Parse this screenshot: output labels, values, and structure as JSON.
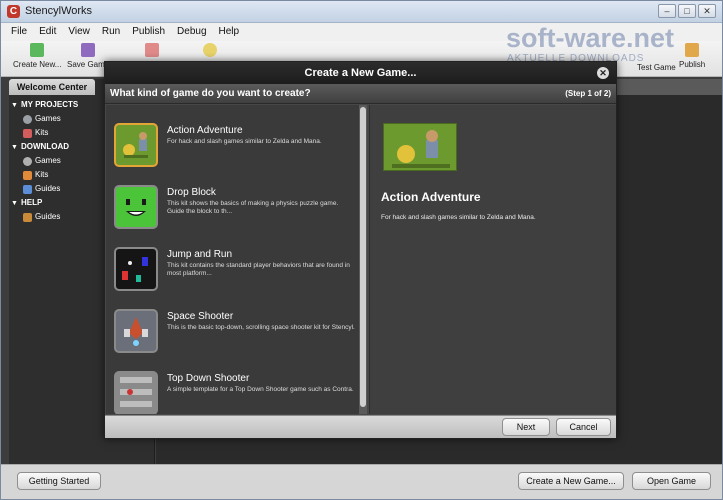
{
  "app": {
    "title": "StencylWorks",
    "logo_letter": "C"
  },
  "window_controls": [
    "–",
    "□",
    "✕"
  ],
  "menu": [
    "File",
    "Edit",
    "View",
    "Run",
    "Publish",
    "Debug",
    "Help"
  ],
  "toolbar": {
    "create_new": "Create New...",
    "save_game": "Save Game",
    "test_game": "Test Game",
    "publish": "Publish"
  },
  "watermark": {
    "brand": "soft-ware.net",
    "tagline": "AKTUELLE DOWNLOADS"
  },
  "sidebar": {
    "tab": "Welcome Center",
    "sections": [
      {
        "label": "MY PROJECTS",
        "items": [
          "Games",
          "Kits"
        ]
      },
      {
        "label": "DOWNLOAD",
        "items": [
          "Games",
          "Kits",
          "Guides"
        ]
      },
      {
        "label": "HELP",
        "items": [
          "Guides"
        ]
      }
    ]
  },
  "bottom": {
    "getting_started": "Getting Started",
    "create_new_game": "Create a New Game...",
    "open_game": "Open Game"
  },
  "dialog": {
    "title": "Create a New Game...",
    "close_icon": "✕",
    "question": "What kind of game do you want to create?",
    "step": "(Step 1 of 2)",
    "kits": [
      {
        "title": "Action Adventure",
        "desc": "For hack and slash games similar to Zelda and Mana.",
        "selected": true
      },
      {
        "title": "Drop Block",
        "desc": "This kit shows the basics of making a physics puzzle game. Guide the block to th...",
        "selected": false
      },
      {
        "title": "Jump and Run",
        "desc": "This kit contains the standard player behaviors that are found in most platform...",
        "selected": false
      },
      {
        "title": "Space Shooter",
        "desc": "This is the basic top-down, scrolling space shooter kit for Stencyl.",
        "selected": false
      },
      {
        "title": "Top Down Shooter",
        "desc": "A simple template for a Top Down Shooter game such as Contra.",
        "selected": false
      }
    ],
    "detail": {
      "title": "Action Adventure",
      "desc": "For hack and slash games similar to Zelda and Mana."
    },
    "next": "Next",
    "cancel": "Cancel"
  }
}
